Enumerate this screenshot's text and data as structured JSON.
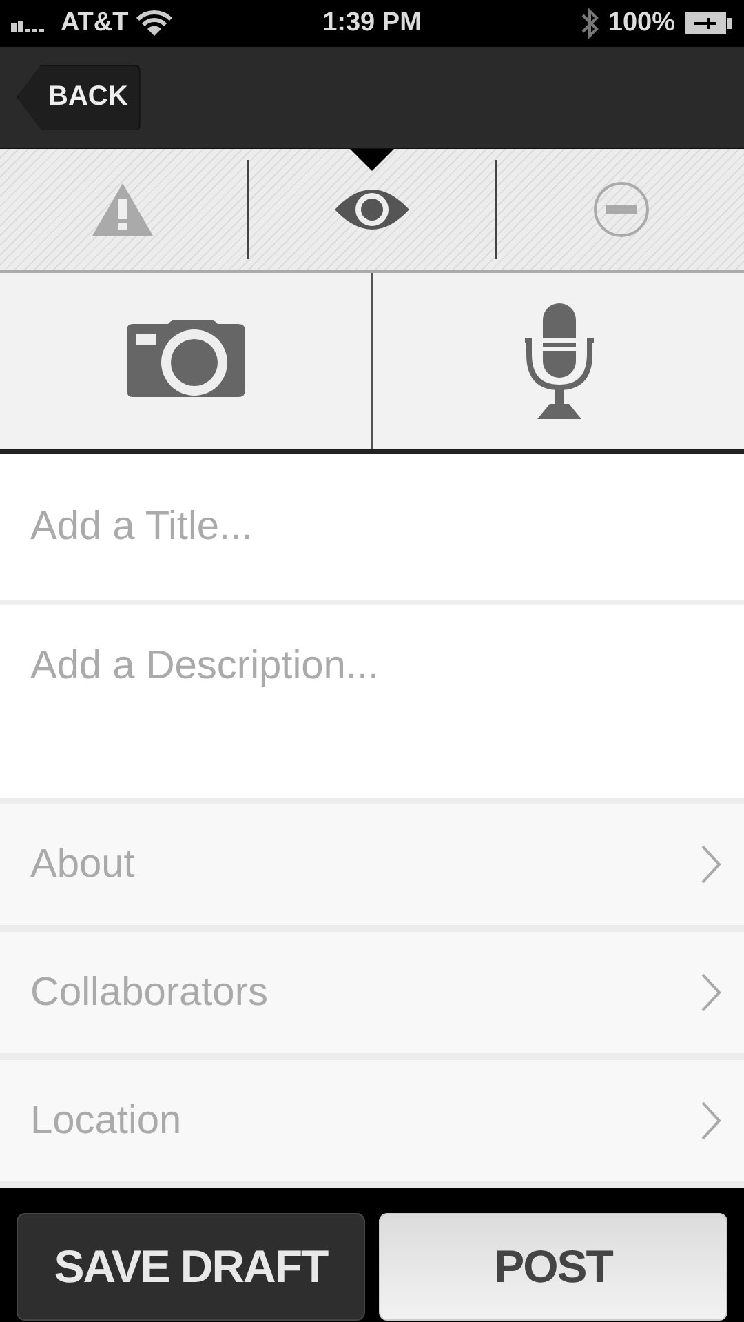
{
  "status_bar": {
    "carrier": "AT&T",
    "time": "1:39 PM",
    "battery": "100%"
  },
  "nav": {
    "back": "BACK"
  },
  "tabs": [
    {
      "kind": "warning",
      "selected": false
    },
    {
      "kind": "eye",
      "selected": true
    },
    {
      "kind": "minus",
      "selected": false
    }
  ],
  "media": [
    {
      "kind": "camera"
    },
    {
      "kind": "microphone"
    }
  ],
  "title": {
    "placeholder": "Add a Title..."
  },
  "description": {
    "placeholder": "Add a Description..."
  },
  "rows": [
    {
      "label": "About"
    },
    {
      "label": "Collaborators"
    },
    {
      "label": "Location"
    }
  ],
  "buttons": [
    {
      "label": "SAVE DRAFT",
      "kind": "dark"
    },
    {
      "label": "POST",
      "kind": "light"
    }
  ]
}
